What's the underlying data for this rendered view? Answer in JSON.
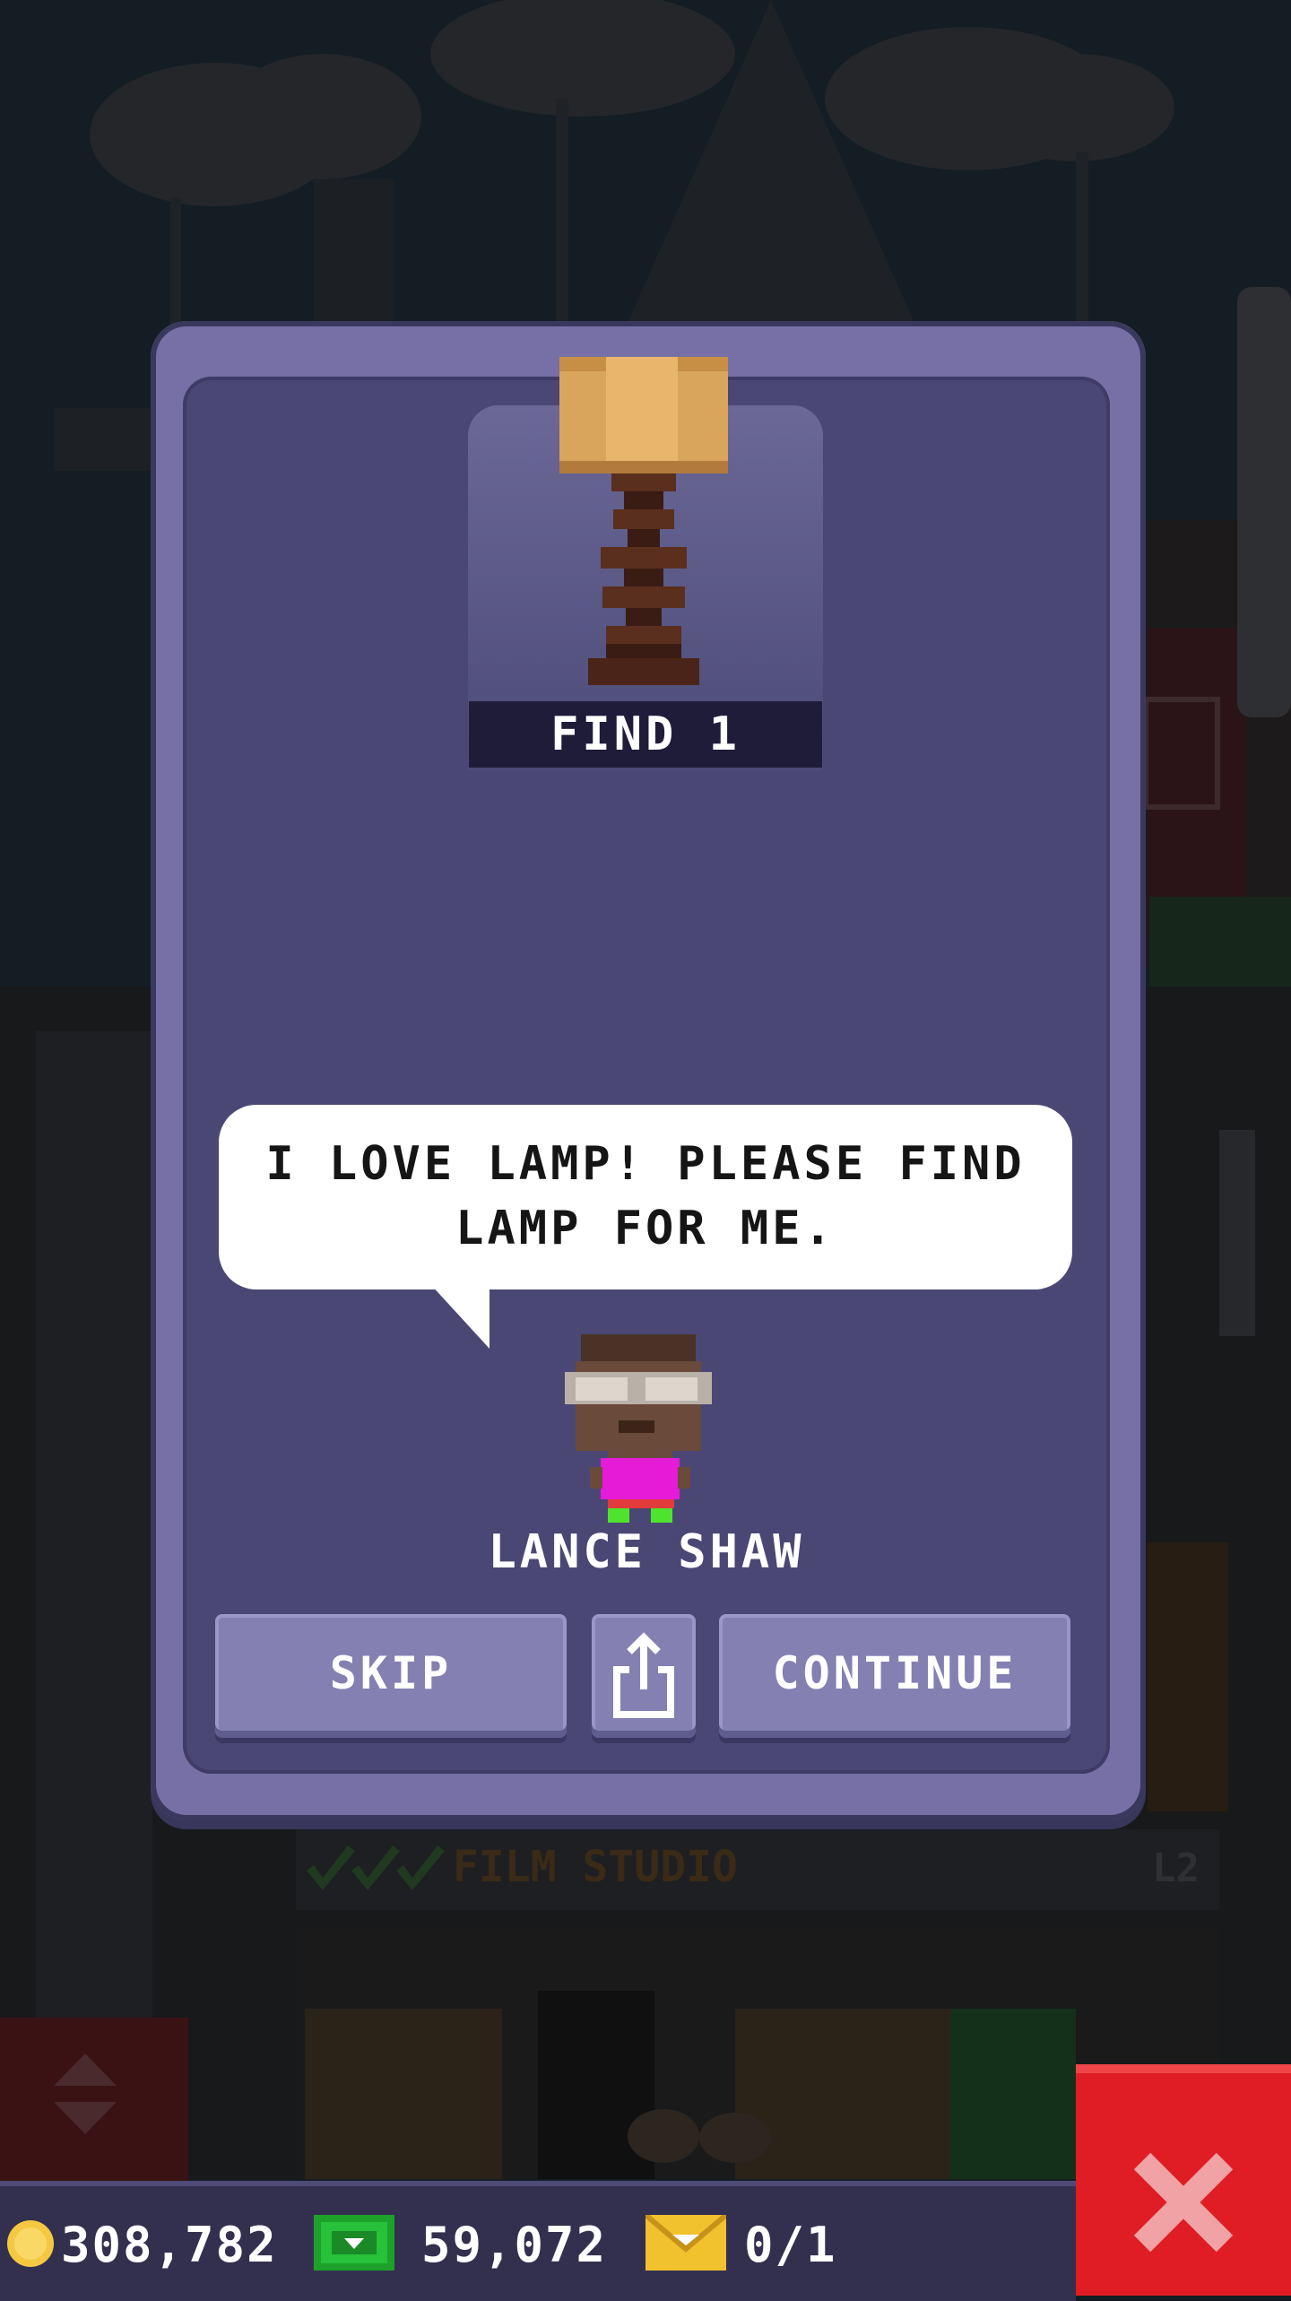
{
  "quest": {
    "goal_label": "FIND 1",
    "item_icon": "lamp-icon"
  },
  "dialog": {
    "speech": "I LOVE LAMP! PLEASE FIND\nLAMP FOR ME.",
    "character_name": "LANCE SHAW"
  },
  "buttons": {
    "skip": "SKIP",
    "share_icon": "share-icon",
    "continue": "CONTINUE"
  },
  "background_sign": {
    "floor_name": "FILM STUDIO",
    "floor_level": "L2"
  },
  "hud": {
    "coins": "308,782",
    "bux": "59,072",
    "vip": "0/1"
  },
  "colors": {
    "modal_border": "#7670a6",
    "modal_fill": "#4a4775",
    "close_button": "#e01c24",
    "bux_green": "#1da12b",
    "coin_gold": "#f5c842"
  }
}
